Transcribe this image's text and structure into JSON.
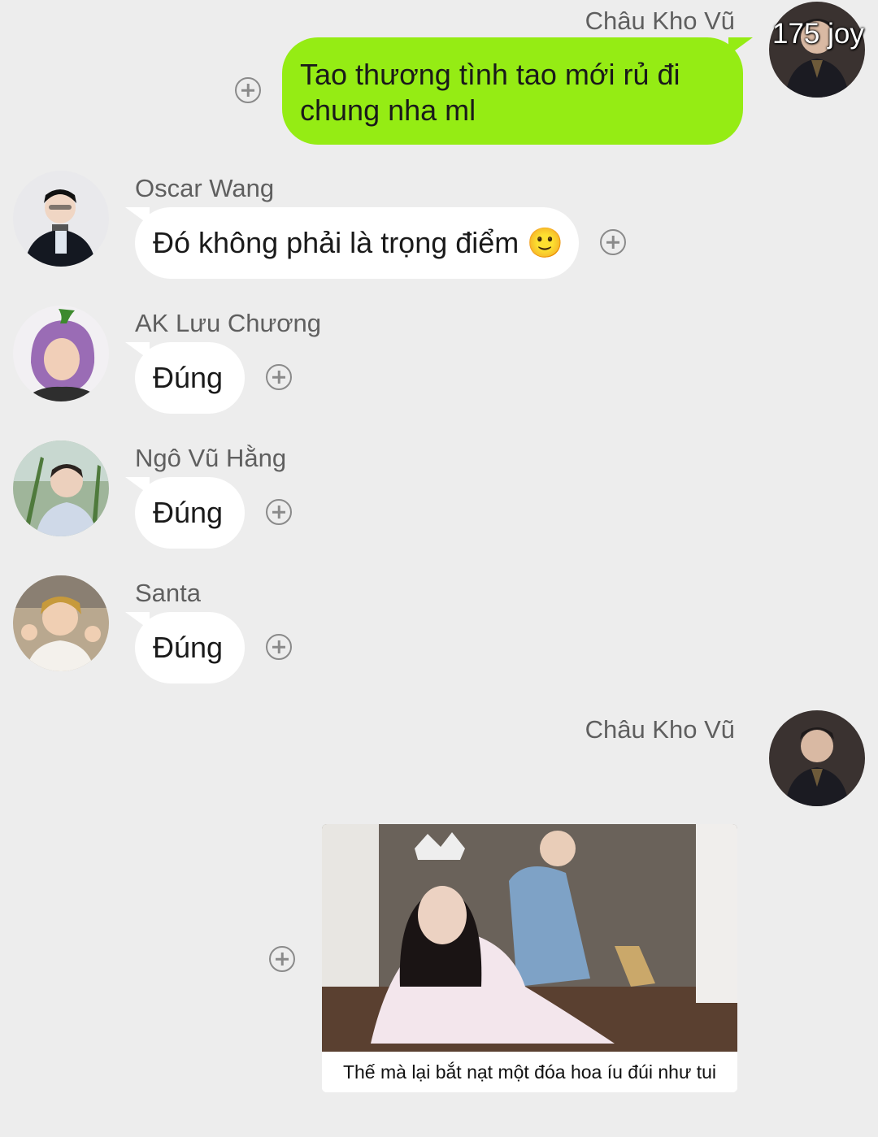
{
  "messages": [
    {
      "sender": "Châu Kho Vũ",
      "direction": "outgoing",
      "text": "Tao thương tình tao mới rủ đi chung nha ml",
      "avatar_badge": "175 joy"
    },
    {
      "sender": "Oscar Wang",
      "direction": "incoming",
      "text": "Đó không phải là trọng điểm 🙂"
    },
    {
      "sender": "AK Lưu Chương",
      "direction": "incoming",
      "text": "Đúng"
    },
    {
      "sender": "Ngô Vũ Hằng",
      "direction": "incoming",
      "text": "Đúng"
    },
    {
      "sender": "Santa",
      "direction": "incoming",
      "text": "Đúng"
    },
    {
      "sender": "Châu Kho Vũ",
      "direction": "outgoing",
      "type": "image",
      "image_caption": "Thế mà lại bắt nạt một đóa hoa íu đúi như tui"
    }
  ],
  "icons": {
    "add": "plus-circle-icon"
  },
  "colors": {
    "background": "#ededed",
    "outgoing_bubble": "#95ec14",
    "incoming_bubble": "#ffffff"
  }
}
